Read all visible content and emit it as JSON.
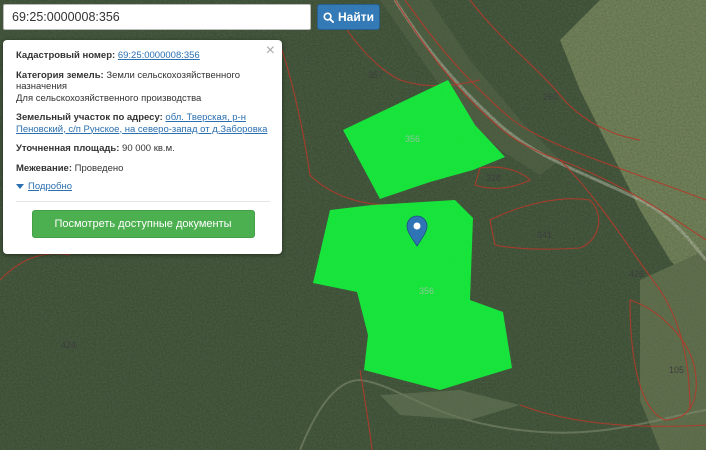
{
  "search": {
    "value": "69:25:0000008:356",
    "button_label": "Найти",
    "icon": "search-icon"
  },
  "info": {
    "close_glyph": "×",
    "cadastral_label": "Кадастровый номер:",
    "cadastral_number": "69:25:0000008:356",
    "category_label": "Категория земель:",
    "category_value": "Земли сельскохозяйственного назначения",
    "usage_value": "Для сельскохозяйственного производства",
    "address_label": "Земельный участок по адресу:",
    "address_value": "обл. Тверская, р-н Пеновский, с/п Рунское, на северо-запад от д.Заборовка",
    "area_label": "Уточненная площадь:",
    "area_value": "90 000 кв.м.",
    "survey_label": "Межевание:",
    "survey_value": "Проведено",
    "details_link": "Подробно",
    "docs_button": "Посмотреть доступные документы"
  },
  "map": {
    "parcel_labels": [
      "357",
      "356",
      "260",
      "328",
      "341",
      "425",
      "356",
      "424",
      "105"
    ],
    "colors": {
      "selected_fill": "#14f03c",
      "boundary": "#b33a2b",
      "marker": "#2f75b5",
      "forest": "#2f4129"
    }
  }
}
